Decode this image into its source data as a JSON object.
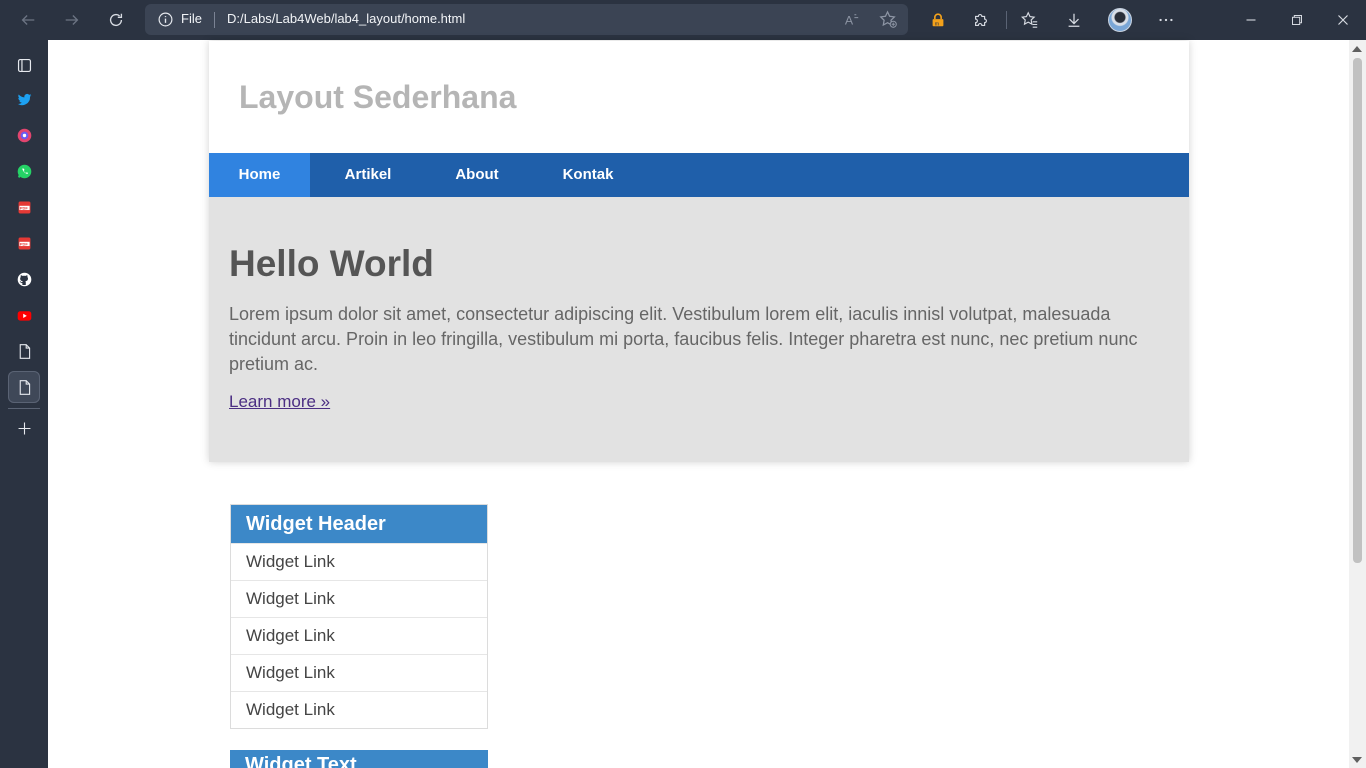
{
  "browser": {
    "address_scheme": "File",
    "url": "D:/Labs/Lab4Web/lab4_layout/home.html"
  },
  "sidebar_icons": [
    "tab-actions-icon",
    "twitter-icon",
    "messenger-icon",
    "whatsapp-icon",
    "pdf-icon",
    "pdf-icon",
    "github-icon",
    "youtube-icon",
    "document-icon",
    "document-icon",
    "add-icon"
  ],
  "site": {
    "title": "Layout Sederhana",
    "nav": [
      "Home",
      "Artikel",
      "About",
      "Kontak"
    ],
    "active_nav": "Home"
  },
  "hero": {
    "title": "Hello World",
    "text": "Lorem ipsum dolor sit amet, consectetur adipiscing elit. Vestibulum lorem elit, iaculis innisl volutpat, malesuada tincidunt arcu. Proin in leo fringilla, vestibulum mi porta, faucibus felis. Integer pharetra est nunc, nec pretium nunc pretium ac.",
    "link": "Learn more »"
  },
  "widgets": [
    {
      "header": "Widget Header",
      "links": [
        "Widget Link",
        "Widget Link",
        "Widget Link",
        "Widget Link",
        "Widget Link"
      ]
    },
    {
      "header": "Widget Text"
    }
  ],
  "colors": {
    "nav_bg": "#1f5faa",
    "nav_active": "#3083e0",
    "hero_bg": "#e2e2e2",
    "widget_header_bg": "#3c88c8"
  }
}
